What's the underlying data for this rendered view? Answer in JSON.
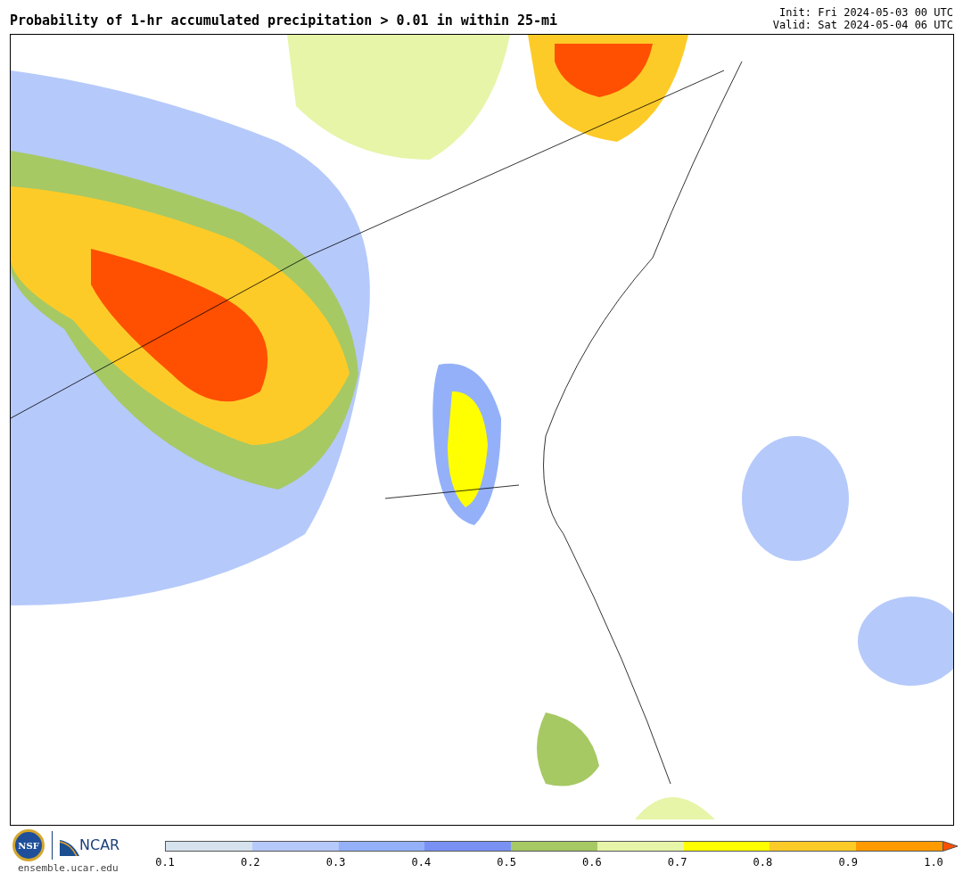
{
  "title": "Probability of 1-hr accumulated precipitation > 0.01 in within 25-mi",
  "init": "Init: Fri 2024-05-03 00 UTC",
  "valid": "Valid: Sat 2024-05-04 06 UTC",
  "logos": {
    "nsf": "NSF",
    "ncar": "NCAR",
    "url": "ensemble.ucar.edu"
  },
  "colorbar": {
    "bins": [
      {
        "color": "#d6e2ed"
      },
      {
        "color": "#b5c9fb"
      },
      {
        "color": "#94b0f9"
      },
      {
        "color": "#7a91f4"
      },
      {
        "color": "#a6c964"
      },
      {
        "color": "#e6f5a8"
      },
      {
        "color": "#ffff00"
      },
      {
        "color": "#fdcb28"
      },
      {
        "color": "#ff9a00"
      },
      {
        "kind": "extend",
        "color": "#ff4f00"
      }
    ],
    "ticks": [
      "0.1",
      "0.2",
      "0.3",
      "0.4",
      "0.5",
      "0.6",
      "0.7",
      "0.8",
      "0.9",
      "1.0"
    ]
  }
}
